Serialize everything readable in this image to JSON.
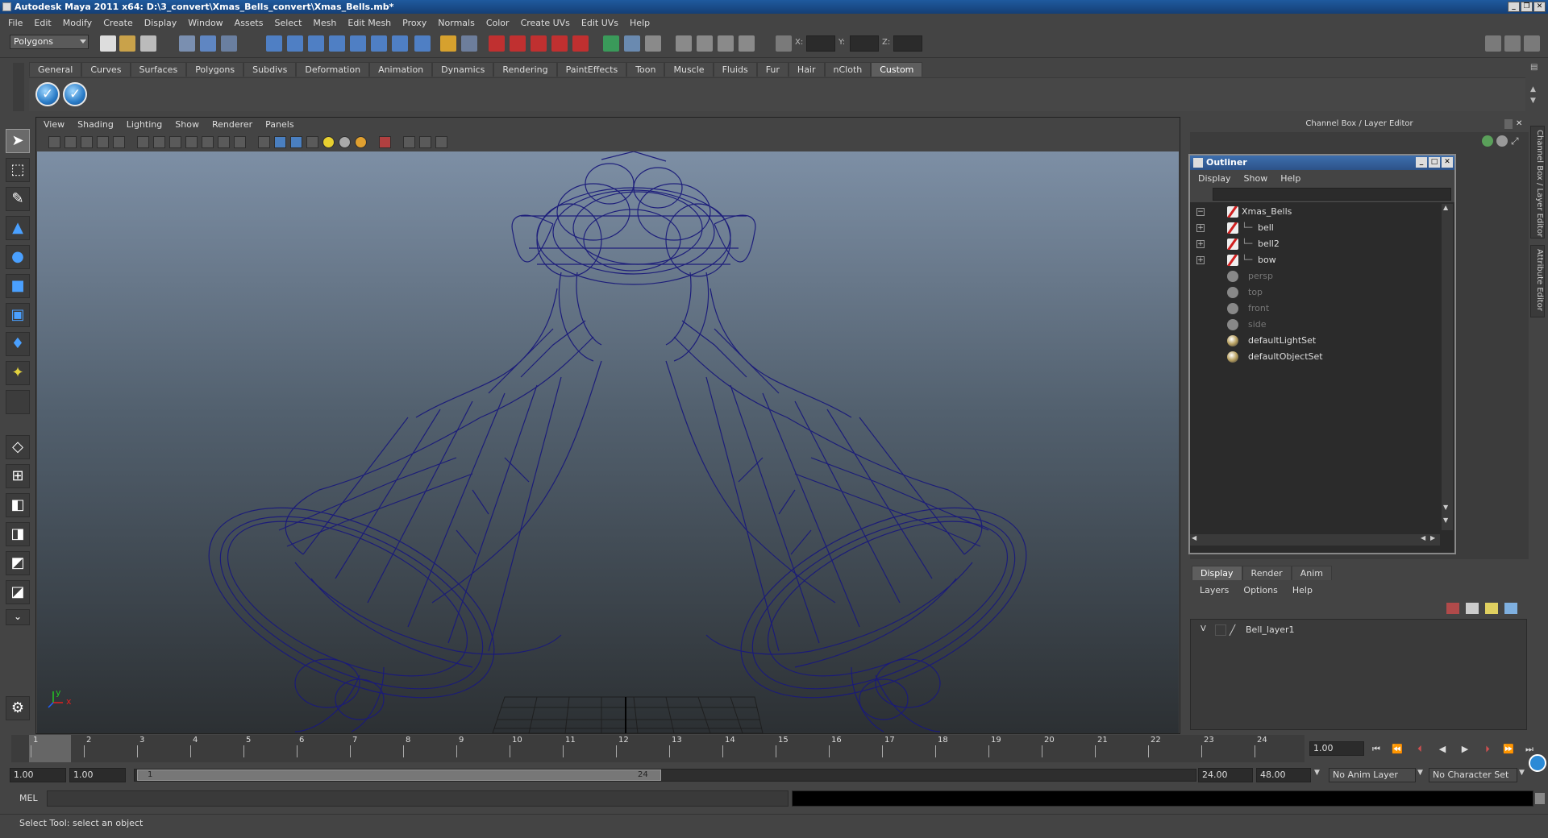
{
  "window": {
    "title": "Autodesk Maya 2011 x64: D:\\3_convert\\Xmas_Bells_convert\\Xmas_Bells.mb*"
  },
  "menubar": [
    "File",
    "Edit",
    "Modify",
    "Create",
    "Display",
    "Window",
    "Assets",
    "Select",
    "Mesh",
    "Edit Mesh",
    "Proxy",
    "Normals",
    "Color",
    "Create UVs",
    "Edit UVs",
    "Help"
  ],
  "statusline": {
    "mode": "Polygons",
    "x_label": "X:",
    "y_label": "Y:",
    "z_label": "Z:"
  },
  "shelf": {
    "tabs": [
      "General",
      "Curves",
      "Surfaces",
      "Polygons",
      "Subdivs",
      "Deformation",
      "Animation",
      "Dynamics",
      "Rendering",
      "PaintEffects",
      "Toon",
      "Muscle",
      "Fluids",
      "Fur",
      "Hair",
      "nCloth",
      "Custom"
    ],
    "active_tab": "Custom"
  },
  "viewport": {
    "menu": [
      "View",
      "Shading",
      "Lighting",
      "Show",
      "Renderer",
      "Panels"
    ],
    "axis_x": "x",
    "axis_y": "y"
  },
  "right_panel": {
    "header": "Channel Box / Layer Editor",
    "side_tab_1": "Channel Box / Layer Editor",
    "side_tab_2": "Attribute Editor"
  },
  "outliner": {
    "title": "Outliner",
    "menu": [
      "Display",
      "Show",
      "Help"
    ],
    "items": [
      {
        "label": "Xmas_Bells",
        "icon": "mesh-icon",
        "expand": "−",
        "dim": false
      },
      {
        "label": "bell",
        "icon": "mesh-icon",
        "expand": "+",
        "dim": false
      },
      {
        "label": "bell2",
        "icon": "mesh-icon",
        "expand": "+",
        "dim": false
      },
      {
        "label": "bow",
        "icon": "mesh-icon",
        "expand": "+",
        "dim": false
      },
      {
        "label": "persp",
        "icon": "camera-icon",
        "expand": "",
        "dim": true
      },
      {
        "label": "top",
        "icon": "camera-icon",
        "expand": "",
        "dim": true
      },
      {
        "label": "front",
        "icon": "camera-icon",
        "expand": "",
        "dim": true
      },
      {
        "label": "side",
        "icon": "camera-icon",
        "expand": "",
        "dim": true
      },
      {
        "label": "defaultLightSet",
        "icon": "set-icon",
        "expand": "",
        "dim": false
      },
      {
        "label": "defaultObjectSet",
        "icon": "set-icon",
        "expand": "",
        "dim": false
      }
    ]
  },
  "layer_editor": {
    "tabs": [
      "Display",
      "Render",
      "Anim"
    ],
    "active_tab": "Display",
    "menu": [
      "Layers",
      "Options",
      "Help"
    ],
    "layers": [
      {
        "visible": "V",
        "name": "Bell_layer1"
      }
    ]
  },
  "timeline": {
    "ticks": [
      "1",
      "2",
      "3",
      "4",
      "5",
      "6",
      "7",
      "8",
      "9",
      "10",
      "11",
      "12",
      "13",
      "14",
      "15",
      "16",
      "17",
      "18",
      "19",
      "20",
      "21",
      "22",
      "23",
      "24"
    ],
    "current_frame": "1",
    "current_frame_field": "1.00"
  },
  "range": {
    "start": "1.00",
    "playback_start": "1.00",
    "slider_start": "1",
    "slider_end": "24",
    "playback_end": "24.00",
    "end": "48.00",
    "anim_layer": "No Anim Layer",
    "character_set": "No Character Set"
  },
  "command": {
    "label": "MEL"
  },
  "help_line": "Select Tool: select an object",
  "colors": {
    "wireframe": "#1a1a7a",
    "title_bar": "#1f5a9e",
    "viewport_top": "#7d8fa5",
    "viewport_bottom": "#2c3033"
  }
}
